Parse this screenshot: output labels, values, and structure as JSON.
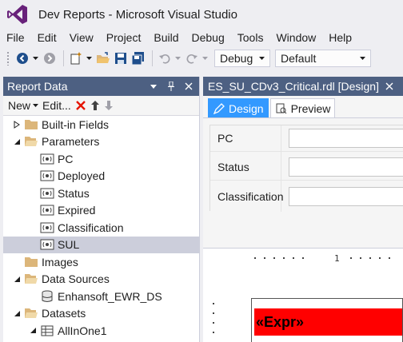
{
  "window": {
    "title": "Dev Reports - Microsoft Visual Studio",
    "logo_icon": "visual-studio-logo",
    "accent_color": "#68217a"
  },
  "menu": [
    "File",
    "Edit",
    "View",
    "Project",
    "Build",
    "Debug",
    "Tools",
    "Window",
    "Help"
  ],
  "toolbar": {
    "buttons": [
      "back-icon",
      "forward-icon",
      "new-item-icon",
      "open-folder-icon",
      "save-icon",
      "save-all-icon",
      "undo-icon",
      "redo-icon"
    ],
    "configuration": "Debug",
    "platform": "Default"
  },
  "report_data": {
    "title": "Report Data",
    "header_color": "#4d6082",
    "new_label": "New",
    "edit_label": "Edit...",
    "tree": [
      {
        "label": "Built-in Fields",
        "level": 0,
        "expander": "collapsed",
        "icon": "folder-icon"
      },
      {
        "label": "Parameters",
        "level": 0,
        "expander": "expanded",
        "icon": "folder-open-icon"
      },
      {
        "label": "PC",
        "level": 1,
        "expander": "none",
        "icon": "parameter-icon"
      },
      {
        "label": "Deployed",
        "level": 1,
        "expander": "none",
        "icon": "parameter-icon"
      },
      {
        "label": "Status",
        "level": 1,
        "expander": "none",
        "icon": "parameter-icon"
      },
      {
        "label": "Expired",
        "level": 1,
        "expander": "none",
        "icon": "parameter-icon"
      },
      {
        "label": "Classification",
        "level": 1,
        "expander": "none",
        "icon": "parameter-icon"
      },
      {
        "label": "SUL",
        "level": 1,
        "expander": "none",
        "icon": "parameter-icon",
        "selected": true
      },
      {
        "label": "Images",
        "level": 0,
        "expander": "none",
        "icon": "folder-icon"
      },
      {
        "label": "Data Sources",
        "level": 0,
        "expander": "expanded",
        "icon": "folder-open-icon"
      },
      {
        "label": "Enhansoft_EWR_DS",
        "level": 1,
        "expander": "none",
        "icon": "datasource-icon"
      },
      {
        "label": "Datasets",
        "level": 0,
        "expander": "expanded",
        "icon": "folder-open-icon"
      },
      {
        "label": "AllInOne1",
        "level": 1,
        "expander": "expanded",
        "icon": "dataset-icon"
      }
    ]
  },
  "document": {
    "tab_title": "ES_SU_CDv3_Critical.rdl [Design]",
    "view_tabs": {
      "design": "Design",
      "preview": "Preview"
    },
    "active_view": "Design",
    "parameters": [
      {
        "label": "PC",
        "value": ""
      },
      {
        "label": "Status",
        "value": ""
      },
      {
        "label": "Classification",
        "value": ""
      }
    ],
    "ruler_number": "1",
    "expression_text": "«Expr»",
    "expression_bg": "#ff0000"
  }
}
